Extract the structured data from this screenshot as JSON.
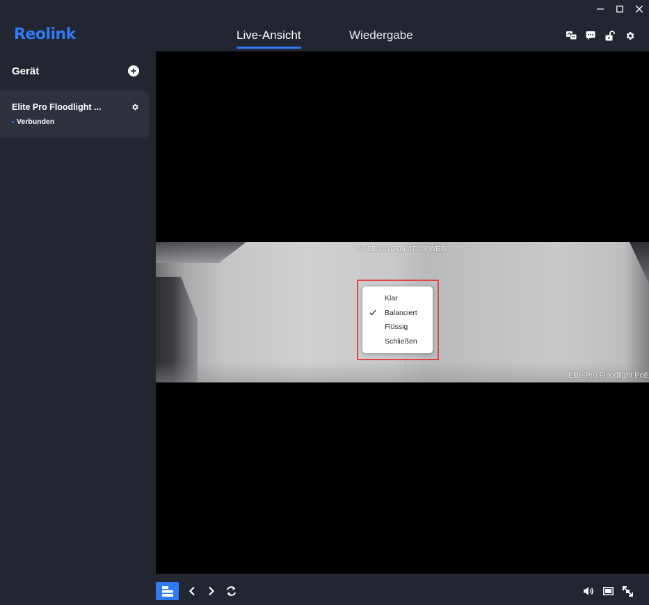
{
  "window": {
    "controls": [
      {
        "name": "minimize-icon"
      },
      {
        "name": "maximize-icon"
      },
      {
        "name": "close-icon"
      }
    ]
  },
  "header": {
    "logo": "Reolink",
    "tabs": [
      {
        "label": "Live-Ansicht",
        "active": true
      },
      {
        "label": "Wiedergabe",
        "active": false
      }
    ],
    "icons": [
      "language-icon",
      "feedback-icon",
      "lock-icon",
      "settings-icon"
    ]
  },
  "sidebar": {
    "title": "Gerät",
    "device": {
      "name": "Elite Pro Floodlight ...",
      "status": "Verbunden"
    }
  },
  "video": {
    "timestamp": "06/05/2026 09:47:03 WED",
    "camera_label": "Elite Pro Floodlight PoE",
    "menu": {
      "items": [
        {
          "label": "Klar",
          "checked": false
        },
        {
          "label": "Balanciert",
          "checked": true
        },
        {
          "label": "Flüssig",
          "checked": false
        },
        {
          "label": "Schließen",
          "checked": false
        }
      ]
    }
  },
  "toolbar": {
    "left": [
      "layout-icon",
      "previous-icon",
      "next-icon",
      "refresh-icon"
    ],
    "right": [
      "volume-icon",
      "stream-icon",
      "fullscreen-icon"
    ]
  },
  "colors": {
    "accent": "#2f7bf6",
    "background": "#222630",
    "card": "#2d323d",
    "highlight": "#e0463b"
  }
}
